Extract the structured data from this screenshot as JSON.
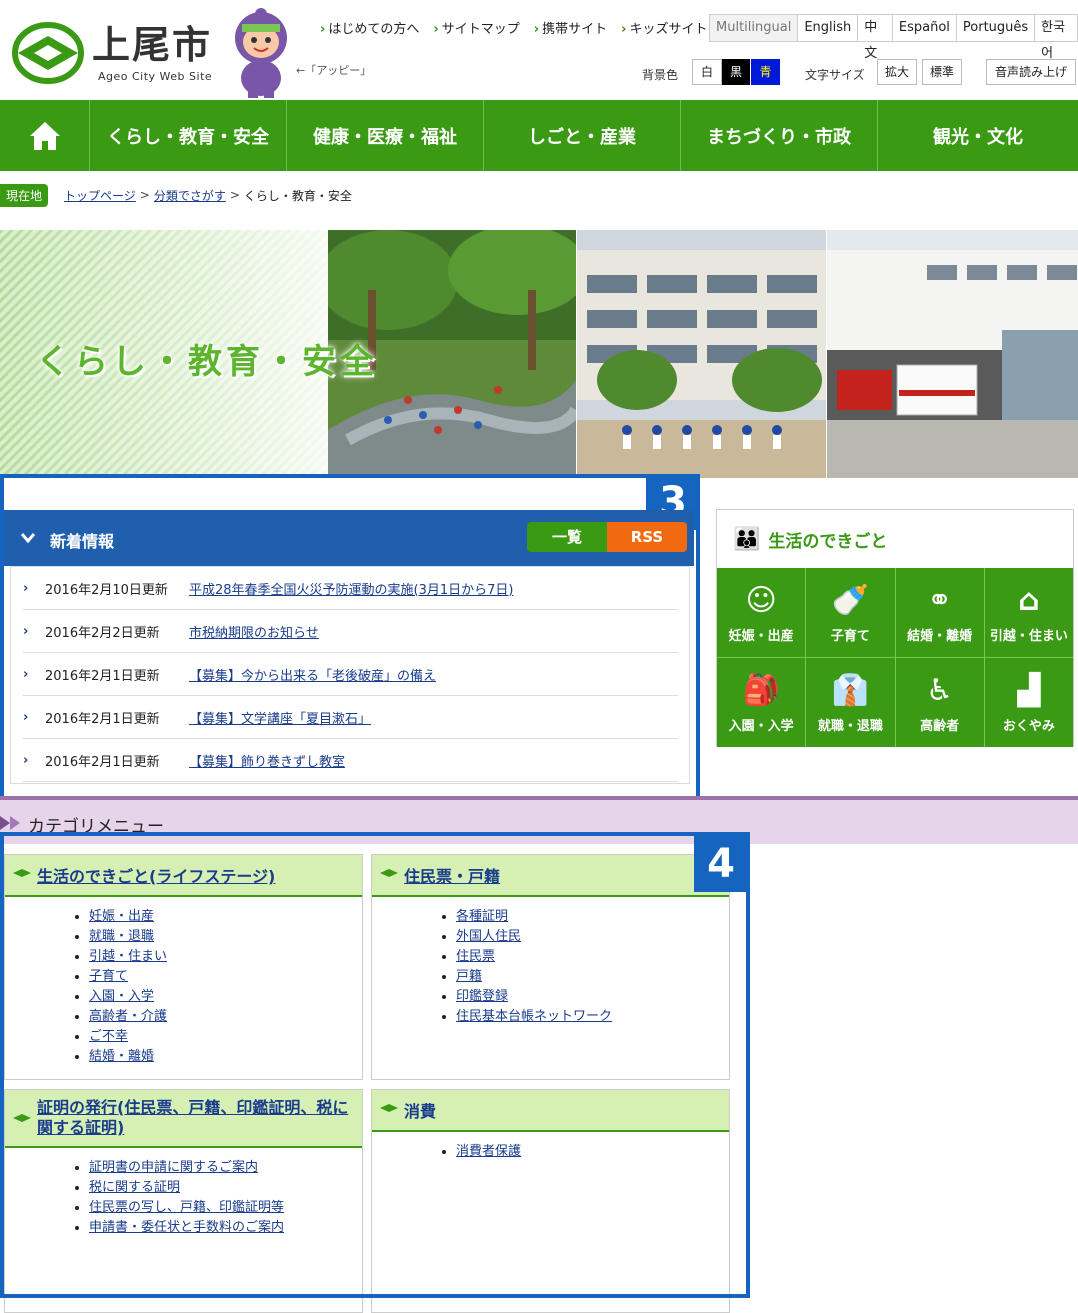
{
  "header": {
    "logo_text": "上尾市",
    "logo_sub": "Ageo City Web Site",
    "mascot_label": "←「アッピー」",
    "toplinks": [
      "はじめての方へ",
      "サイトマップ",
      "携帯サイト",
      "キッズサイト"
    ],
    "lang": [
      "Multilingual",
      "English",
      "中文",
      "Español",
      "Português",
      "한국어"
    ],
    "bg_label": "背景色",
    "bg_options": [
      "白",
      "黒",
      "青"
    ],
    "font_label": "文字サイズ",
    "font_options": [
      "拡大",
      "標準"
    ],
    "speech": "音声読み上げ"
  },
  "nav": [
    "くらし・教育・安全",
    "健康・医療・福祉",
    "しごと・産業",
    "まちづくり・市政",
    "観光・文化"
  ],
  "breadcrumb": {
    "tag": "現在地",
    "items": [
      "トップページ",
      "分類でさがす",
      "くらし・教育・安全"
    ]
  },
  "hero": {
    "title": "くらし・教育・安全"
  },
  "news": {
    "badge": "3",
    "title": "新着情報",
    "list_button": "一覧",
    "rss_button": "RSS",
    "rows": [
      {
        "date": "2016年2月10日更新",
        "title": "平成28年春季全国火災予防運動の実施(3月1日から7日)"
      },
      {
        "date": "2016年2月2日更新",
        "title": "市税納期限のお知らせ"
      },
      {
        "date": "2016年2月1日更新",
        "title": "【募集】今から出来る「老後破産」の備え"
      },
      {
        "date": "2016年2月1日更新",
        "title": "【募集】文学講座「夏目漱石」"
      },
      {
        "date": "2016年2月1日更新",
        "title": "【募集】飾り巻きずし教室"
      }
    ]
  },
  "life": {
    "title": "生活のできごと",
    "items": [
      {
        "label": "妊娠・出産",
        "icon": "baby-icon"
      },
      {
        "label": "子育て",
        "icon": "bottle-icon"
      },
      {
        "label": "結婚・離婚",
        "icon": "couple-icon"
      },
      {
        "label": "引越・住まい",
        "icon": "house-icon"
      },
      {
        "label": "入園・入学",
        "icon": "backpack-icon"
      },
      {
        "label": "就職・退職",
        "icon": "shirt-icon"
      },
      {
        "label": "高齢者",
        "icon": "cane-icon"
      },
      {
        "label": "おくやみ",
        "icon": "tomb-icon"
      }
    ]
  },
  "category": {
    "title": "カテゴリメニュー",
    "badge": "4",
    "boxes": [
      {
        "title": "生活のできごと(ライフステージ)",
        "items": [
          "妊娠・出産",
          "就職・退職",
          "引越・住まい",
          "子育て",
          "入園・入学",
          "高齢者・介護",
          "ご不幸",
          "結婚・離婚"
        ]
      },
      {
        "title": "住民票・戸籍",
        "items": [
          "各種証明",
          "外国人住民",
          "住民票",
          "戸籍",
          "印鑑登録",
          "住民基本台帳ネットワーク"
        ]
      },
      {
        "title": "証明の発行(住民票、戸籍、印鑑証明、税に関する証明)",
        "items": [
          "証明書の申請に関するご案内",
          "税に関する証明",
          "住民票の写し、戸籍、印鑑証明等",
          "申請書・委任状と手数料のご案内"
        ]
      },
      {
        "title": "消費",
        "items": [
          "消費者保護"
        ]
      }
    ]
  },
  "colors": {
    "green": "#3a9a14",
    "blue": "#1565c0",
    "orange": "#f26a10"
  }
}
